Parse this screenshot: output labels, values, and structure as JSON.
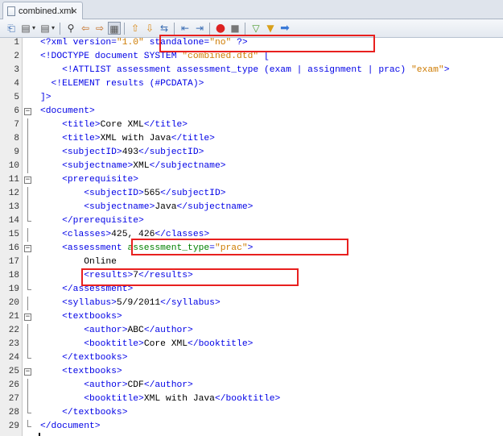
{
  "tab": {
    "title": "combined.xml",
    "close_label": "×"
  },
  "toolbar": {
    "icons": [
      "back-icon",
      "dropdown-icon",
      "forward-icon",
      "dropdown-icon",
      "find-icon",
      "find-prev-icon",
      "find-next-icon",
      "toggle-highlight-icon",
      "shift-left-icon",
      "shift-right-icon",
      "toggle-comment-icon",
      "uncomment-icon",
      "record-macro-icon",
      "stop-macro-icon",
      "check-xml-icon",
      "validate-xml-icon",
      "xsl-transform-icon"
    ]
  },
  "colors": {
    "tag": "#0000e6",
    "attr": "#008000",
    "string": "#ce7b00",
    "highlight_box": "#e8201f"
  },
  "lines": [
    {
      "n": "1",
      "fold": "",
      "parts": [
        [
          "t",
          "<?xml version="
        ],
        [
          "s",
          "\"1.0\""
        ],
        [
          "t",
          " standalone="
        ],
        [
          "s",
          "\"no\""
        ],
        [
          "t",
          " ?>"
        ]
      ]
    },
    {
      "n": "2",
      "fold": "",
      "parts": [
        [
          "t",
          "<!DOCTYPE document SYSTEM "
        ],
        [
          "s",
          "\"combined.dtd\""
        ],
        [
          "t",
          " ["
        ]
      ]
    },
    {
      "n": "3",
      "fold": "",
      "parts": [
        [
          "t",
          "    <!ATTLIST assessment assessment_type (exam | assignment | prac) "
        ],
        [
          "s",
          "\"exam\""
        ],
        [
          "t",
          ">"
        ]
      ]
    },
    {
      "n": "4",
      "fold": "",
      "parts": [
        [
          "t",
          "  <!ELEMENT results (#PCDATA)>"
        ]
      ]
    },
    {
      "n": "5",
      "fold": "",
      "parts": [
        [
          "t",
          "]>"
        ]
      ]
    },
    {
      "n": "6",
      "fold": "open",
      "parts": [
        [
          "t",
          "<document>"
        ]
      ]
    },
    {
      "n": "7",
      "fold": "line",
      "parts": [
        [
          "t",
          "    <title>"
        ],
        [
          "x",
          "Core XML"
        ],
        [
          "t",
          "</title>"
        ]
      ]
    },
    {
      "n": "8",
      "fold": "line",
      "parts": [
        [
          "t",
          "    <title>"
        ],
        [
          "x",
          "XML with Java"
        ],
        [
          "t",
          "</title>"
        ]
      ]
    },
    {
      "n": "9",
      "fold": "line",
      "parts": [
        [
          "t",
          "    <subjectID>"
        ],
        [
          "x",
          "493"
        ],
        [
          "t",
          "</subjectID>"
        ]
      ]
    },
    {
      "n": "10",
      "fold": "line",
      "parts": [
        [
          "t",
          "    <subjectname>"
        ],
        [
          "x",
          "XML"
        ],
        [
          "t",
          "</subjectname>"
        ]
      ]
    },
    {
      "n": "11",
      "fold": "open",
      "parts": [
        [
          "t",
          "    <prerequisite>"
        ]
      ]
    },
    {
      "n": "12",
      "fold": "line",
      "parts": [
        [
          "t",
          "        <subjectID>"
        ],
        [
          "x",
          "565"
        ],
        [
          "t",
          "</subjectID>"
        ]
      ]
    },
    {
      "n": "13",
      "fold": "line",
      "parts": [
        [
          "t",
          "        <subjectname>"
        ],
        [
          "x",
          "Java"
        ],
        [
          "t",
          "</subjectname>"
        ]
      ]
    },
    {
      "n": "14",
      "fold": "end",
      "parts": [
        [
          "t",
          "    </prerequisite>"
        ]
      ]
    },
    {
      "n": "15",
      "fold": "line",
      "parts": [
        [
          "t",
          "    <classes>"
        ],
        [
          "x",
          "425, 426"
        ],
        [
          "t",
          "</classes>"
        ]
      ]
    },
    {
      "n": "16",
      "fold": "open",
      "parts": [
        [
          "t",
          "    <assessment "
        ],
        [
          "a",
          "assessment_type"
        ],
        [
          "t",
          "="
        ],
        [
          "s",
          "\"prac\""
        ],
        [
          "t",
          ">"
        ]
      ]
    },
    {
      "n": "17",
      "fold": "line",
      "parts": [
        [
          "x",
          "        Online"
        ]
      ]
    },
    {
      "n": "18",
      "fold": "line",
      "parts": [
        [
          "t",
          "        <results>"
        ],
        [
          "x",
          "7"
        ],
        [
          "t",
          "</results>"
        ]
      ]
    },
    {
      "n": "19",
      "fold": "end",
      "parts": [
        [
          "t",
          "    </assessment>"
        ]
      ]
    },
    {
      "n": "20",
      "fold": "line",
      "parts": [
        [
          "t",
          "    <syllabus>"
        ],
        [
          "x",
          "5/9/2011"
        ],
        [
          "t",
          "</syllabus>"
        ]
      ]
    },
    {
      "n": "21",
      "fold": "open",
      "parts": [
        [
          "t",
          "    <textbooks>"
        ]
      ]
    },
    {
      "n": "22",
      "fold": "line",
      "parts": [
        [
          "t",
          "        <author>"
        ],
        [
          "x",
          "ABC"
        ],
        [
          "t",
          "</author>"
        ]
      ]
    },
    {
      "n": "23",
      "fold": "line",
      "parts": [
        [
          "t",
          "        <booktitle>"
        ],
        [
          "x",
          "Core XML"
        ],
        [
          "t",
          "</booktitle>"
        ]
      ]
    },
    {
      "n": "24",
      "fold": "end",
      "parts": [
        [
          "t",
          "    </textbooks>"
        ]
      ]
    },
    {
      "n": "25",
      "fold": "open",
      "parts": [
        [
          "t",
          "    <textbooks>"
        ]
      ]
    },
    {
      "n": "26",
      "fold": "line",
      "parts": [
        [
          "t",
          "        <author>"
        ],
        [
          "x",
          "CDF"
        ],
        [
          "t",
          "</author>"
        ]
      ]
    },
    {
      "n": "27",
      "fold": "line",
      "parts": [
        [
          "t",
          "        <booktitle>"
        ],
        [
          "x",
          "XML with Java"
        ],
        [
          "t",
          "</booktitle>"
        ]
      ]
    },
    {
      "n": "28",
      "fold": "end",
      "parts": [
        [
          "t",
          "    </textbooks>"
        ]
      ]
    },
    {
      "n": "29",
      "fold": "end",
      "parts": [
        [
          "t",
          "</document>"
        ]
      ]
    }
  ]
}
